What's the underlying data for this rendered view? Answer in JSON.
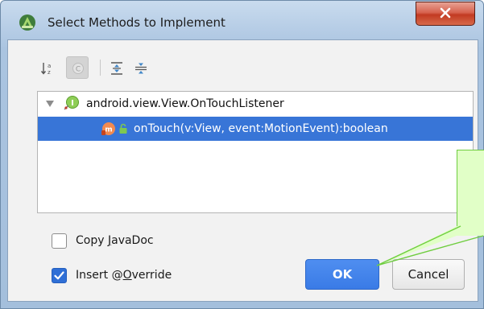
{
  "window": {
    "title": "Select Methods to Implement",
    "app_icon": "android-studio-icon",
    "close_icon": "close-x-icon"
  },
  "toolbar": {
    "buttons": [
      {
        "icon": "sort-alphabetically-icon",
        "active": false
      },
      {
        "icon": "group-by-class-icon",
        "active": true,
        "label": "C"
      },
      {
        "icon": "expand-all-icon",
        "active": false
      },
      {
        "icon": "collapse-all-icon",
        "active": false
      }
    ]
  },
  "tree": {
    "interface": {
      "label": "android.view.View.OnTouchListener",
      "icon": "interface-icon",
      "expanded": true
    },
    "methods": [
      {
        "label": "onTouch(v:View, event:MotionEvent):boolean",
        "icon": "abstract-method-icon",
        "access_icon": "public-access-icon",
        "selected": true
      }
    ]
  },
  "options": {
    "copy_javadoc": {
      "before": "Copy ",
      "mnemonic": "J",
      "after": "avaDoc",
      "checked": false
    },
    "insert_override": {
      "before": "Insert @",
      "mnemonic": "O",
      "after": "verride",
      "checked": true
    }
  },
  "buttons": {
    "ok": "OK",
    "cancel": "Cancel"
  },
  "colors": {
    "selection": "#3875d7",
    "ok_button": "#3a7be6",
    "callout_fill": "#e1ffc7",
    "callout_border": "#6fcd3f"
  }
}
